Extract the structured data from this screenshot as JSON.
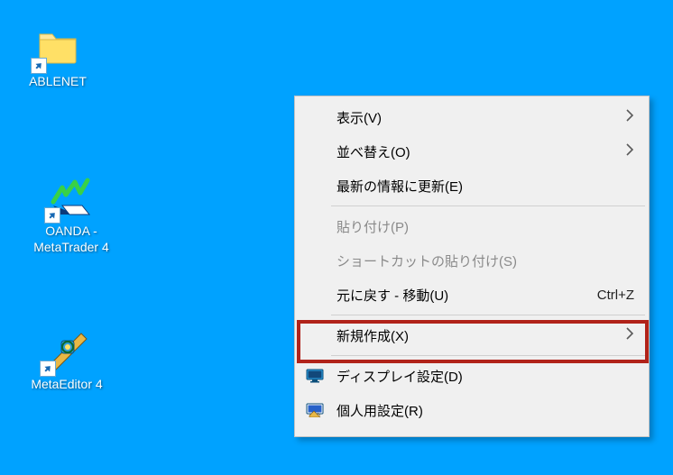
{
  "desktop": {
    "icons": [
      {
        "label": "ABLENET",
        "type": "folder"
      },
      {
        "label": "OANDA - MetaTrader 4",
        "type": "app-mt4"
      },
      {
        "label": "MetaEditor 4",
        "type": "app-me4"
      }
    ]
  },
  "context_menu": {
    "items": [
      {
        "label": "表示(V)",
        "submenu": true,
        "enabled": true,
        "icon": ""
      },
      {
        "label": "並べ替え(O)",
        "submenu": true,
        "enabled": true,
        "icon": ""
      },
      {
        "label": "最新の情報に更新(E)",
        "submenu": false,
        "enabled": true,
        "icon": ""
      },
      {
        "separator": true
      },
      {
        "label": "貼り付け(P)",
        "submenu": false,
        "enabled": false,
        "icon": ""
      },
      {
        "label": "ショートカットの貼り付け(S)",
        "submenu": false,
        "enabled": false,
        "icon": ""
      },
      {
        "label": "元に戻す - 移動(U)",
        "submenu": false,
        "enabled": true,
        "shortcut": "Ctrl+Z",
        "icon": ""
      },
      {
        "separator": true
      },
      {
        "label": "新規作成(X)",
        "submenu": true,
        "enabled": true,
        "highlighted": true,
        "icon": ""
      },
      {
        "separator": true
      },
      {
        "label": "ディスプレイ設定(D)",
        "submenu": false,
        "enabled": true,
        "icon": "monitor-icon"
      },
      {
        "label": "個人用設定(R)",
        "submenu": false,
        "enabled": true,
        "icon": "personalize-icon"
      }
    ]
  }
}
